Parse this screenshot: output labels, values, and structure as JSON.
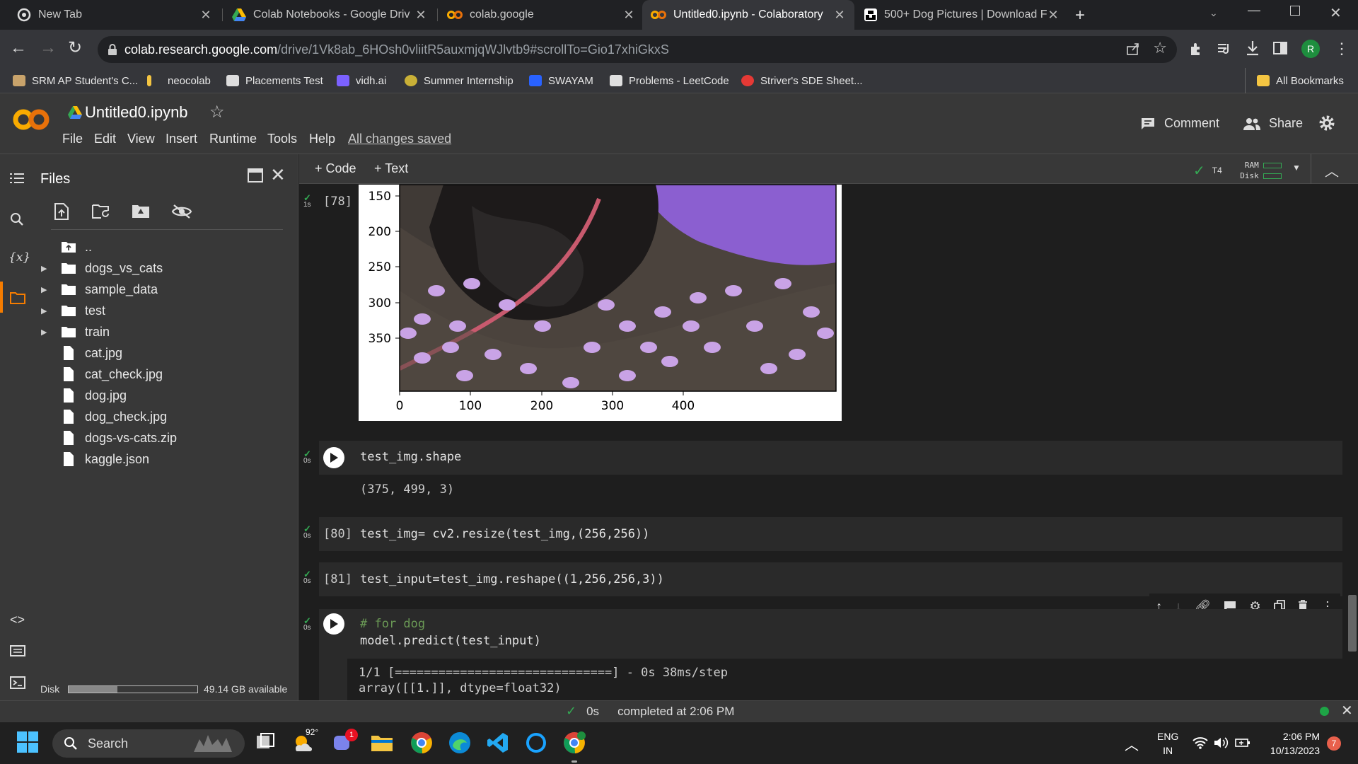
{
  "tabs": [
    {
      "title": "New Tab",
      "active": false
    },
    {
      "title": "Colab Notebooks - Google Driv",
      "active": false
    },
    {
      "title": "colab.google",
      "active": false
    },
    {
      "title": "Untitled0.ipynb - Colaboratory",
      "active": true
    },
    {
      "title": "500+ Dog Pictures | Download F",
      "active": false
    }
  ],
  "address": {
    "domain": "colab.research.google.com",
    "path": "/drive/1Vk8ab_6HOsh0vliitR5auxmjqWJlvtb9#scrollTo=Gio17xhiGkxS",
    "avatar": "R"
  },
  "bookmarks": [
    "SRM AP Student's C...",
    "neocolab",
    "Placements Test",
    "vidh.ai",
    "Summer Internship",
    "SWAYAM",
    "Problems - LeetCode",
    "Striver's SDE Sheet...",
    "All Bookmarks"
  ],
  "colab": {
    "notebook_title": "Untitled0.ipynb",
    "menu": [
      "File",
      "Edit",
      "View",
      "Insert",
      "Runtime",
      "Tools",
      "Help"
    ],
    "saved": "All changes saved",
    "comment": "Comment",
    "share": "Share",
    "add_code": "+ Code",
    "add_text": "+ Text",
    "runtime": "T4",
    "ram": "RAM",
    "disk": "Disk"
  },
  "files_panel": {
    "title": "Files",
    "items": [
      {
        "name": "..",
        "type": "up"
      },
      {
        "name": "dogs_vs_cats",
        "type": "folder"
      },
      {
        "name": "sample_data",
        "type": "folder"
      },
      {
        "name": "test",
        "type": "folder"
      },
      {
        "name": "train",
        "type": "folder"
      },
      {
        "name": "cat.jpg",
        "type": "file"
      },
      {
        "name": "cat_check.jpg",
        "type": "file"
      },
      {
        "name": "dog.jpg",
        "type": "file"
      },
      {
        "name": "dog_check.jpg",
        "type": "file"
      },
      {
        "name": "dogs-vs-cats.zip",
        "type": "file"
      },
      {
        "name": "kaggle.json",
        "type": "file"
      }
    ],
    "disk_label": "Disk",
    "disk_available": "49.14 GB available",
    "disk_used_fraction": 0.38
  },
  "cells": [
    {
      "exec": "[78]",
      "time": "1s",
      "image_yticks": [
        "150",
        "200",
        "250",
        "300",
        "350"
      ],
      "image_xticks": [
        "0",
        "100",
        "200",
        "300",
        "400"
      ]
    },
    {
      "exec": "",
      "time": "0s",
      "code": "test_img.shape",
      "output": "(375, 499, 3)"
    },
    {
      "exec": "[80]",
      "time": "0s",
      "code": "test_img= cv2.resize(test_img,(256,256))"
    },
    {
      "exec": "[81]",
      "time": "0s",
      "code": "test_input=test_img.reshape((1,256,256,3))"
    },
    {
      "exec": "",
      "time": "0s",
      "code_comment": "# for dog",
      "code": "model.predict(test_input)",
      "output_1": "1/1 [==============================] - 0s 38ms/step",
      "output_2": "array([[1.]], dtype=float32)"
    }
  ],
  "status": {
    "time": "0s",
    "message": "completed at 2:06 PM"
  },
  "taskbar": {
    "search": "Search",
    "weather": "92°",
    "chat_badge": "1",
    "lang_1": "ENG",
    "lang_2": "IN",
    "time": "2:06 PM",
    "date": "10/13/2023",
    "notif": "7"
  }
}
